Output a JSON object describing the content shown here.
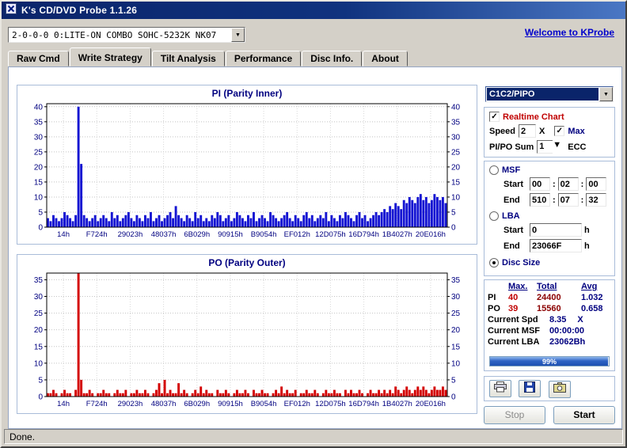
{
  "window": {
    "title": "K's CD/DVD Probe 1.1.26",
    "status": "Done."
  },
  "icons": {
    "dropdown": "▼",
    "check": "✓"
  },
  "toolbar": {
    "drive": "2-0-0-0 0:LITE-ON COMBO SOHC-5232K NK07",
    "welcome": "Welcome to KProbe"
  },
  "tabs": [
    {
      "label": "Raw Cmd"
    },
    {
      "label": "Write Strategy"
    },
    {
      "label": "Tilt Analysis"
    },
    {
      "label": "Performance"
    },
    {
      "label": "Disc Info."
    },
    {
      "label": "About"
    }
  ],
  "controls": {
    "mode": "C1C2/PIPO",
    "realtime": "Realtime Chart",
    "speed_label": "Speed",
    "speed_value": "2",
    "speed_unit": "X",
    "max_label": "Max",
    "sum_label": "PI/PO Sum",
    "sum_value": "1",
    "ecc_label": "ECC",
    "msf": {
      "label": "MSF",
      "start_label": "Start",
      "end_label": "End",
      "sep": ":",
      "start": [
        "00",
        "02",
        "00"
      ],
      "end": [
        "510",
        "07",
        "32"
      ]
    },
    "lba": {
      "label": "LBA",
      "start_label": "Start",
      "end_label": "End",
      "unit": "h",
      "start": "0",
      "end": "23066F"
    },
    "disc_size": "Disc Size",
    "stats": {
      "col_max": "Max.",
      "col_total": "Total",
      "col_avg": "Avg",
      "pi": {
        "name": "PI",
        "max": "40",
        "total": "24400",
        "avg": "1.032"
      },
      "po": {
        "name": "PO",
        "max": "39",
        "total": "15560",
        "avg": "0.658"
      },
      "current_spd_label": "Current Spd",
      "current_spd_value": "8.35",
      "current_spd_unit": "X",
      "current_msf_label": "Current MSF",
      "current_msf_value": "00:00:00",
      "current_lba_label": "Current LBA",
      "current_lba_value": "23062Bh",
      "progress_pct": 99,
      "progress_label": "99%"
    },
    "stop": "Stop",
    "start": "Start"
  },
  "chart_data": [
    {
      "type": "bar",
      "title": "PI (Parity Inner)",
      "color": "#1414d2",
      "ylim": [
        0,
        41
      ],
      "yticks": [
        0,
        5,
        10,
        15,
        20,
        25,
        30,
        35,
        40
      ],
      "x_labels": [
        "14h",
        "F724h",
        "29023h",
        "48037h",
        "6B029h",
        "90915h",
        "B9054h",
        "EF012h",
        "12D075h",
        "16D794h",
        "1B4027h",
        "20E016h"
      ],
      "values": [
        3,
        2,
        4,
        3,
        2,
        3,
        5,
        4,
        3,
        2,
        4,
        40,
        21,
        4,
        3,
        2,
        3,
        4,
        2,
        3,
        4,
        3,
        2,
        5,
        3,
        4,
        2,
        3,
        4,
        5,
        3,
        2,
        4,
        3,
        2,
        4,
        3,
        5,
        2,
        3,
        4,
        2,
        3,
        4,
        5,
        3,
        7,
        4,
        3,
        2,
        4,
        3,
        2,
        5,
        3,
        4,
        2,
        3,
        2,
        4,
        3,
        5,
        4,
        2,
        3,
        4,
        2,
        3,
        5,
        4,
        3,
        2,
        4,
        3,
        5,
        2,
        3,
        4,
        3,
        2,
        5,
        4,
        3,
        2,
        3,
        4,
        5,
        3,
        2,
        4,
        3,
        2,
        4,
        5,
        3,
        4,
        2,
        3,
        4,
        3,
        5,
        2,
        4,
        3,
        2,
        4,
        3,
        5,
        4,
        3,
        2,
        4,
        5,
        3,
        4,
        2,
        3,
        4,
        5,
        4,
        5,
        6,
        5,
        7,
        6,
        8,
        7,
        6,
        9,
        8,
        10,
        9,
        8,
        10,
        11,
        9,
        10,
        8,
        9,
        11,
        10,
        9,
        10,
        8
      ]
    },
    {
      "type": "bar",
      "title": "PO (Parity Outer)",
      "color": "#d40000",
      "ylim": [
        0,
        37
      ],
      "yticks": [
        0,
        5,
        10,
        15,
        20,
        25,
        30,
        35
      ],
      "x_labels": [
        "14h",
        "F724h",
        "29023h",
        "48037h",
        "6B029h",
        "90915h",
        "B9054h",
        "EF012h",
        "12D075h",
        "16D794h",
        "1B4027h",
        "20E016h"
      ],
      "values": [
        1,
        1,
        2,
        1,
        0,
        1,
        2,
        1,
        1,
        0,
        2,
        39,
        5,
        1,
        1,
        2,
        1,
        0,
        1,
        1,
        2,
        1,
        1,
        0,
        1,
        2,
        1,
        1,
        2,
        0,
        1,
        1,
        2,
        1,
        1,
        2,
        1,
        0,
        1,
        2,
        4,
        1,
        5,
        1,
        2,
        1,
        1,
        4,
        1,
        2,
        1,
        0,
        1,
        2,
        1,
        3,
        1,
        2,
        1,
        1,
        0,
        2,
        1,
        1,
        2,
        1,
        0,
        1,
        2,
        1,
        1,
        2,
        1,
        0,
        2,
        1,
        1,
        2,
        1,
        1,
        0,
        1,
        2,
        1,
        3,
        1,
        2,
        1,
        1,
        2,
        0,
        1,
        1,
        2,
        1,
        1,
        2,
        1,
        0,
        1,
        2,
        1,
        1,
        2,
        1,
        1,
        0,
        2,
        1,
        2,
        1,
        1,
        2,
        1,
        0,
        1,
        2,
        1,
        1,
        2,
        1,
        2,
        1,
        2,
        1,
        3,
        2,
        1,
        2,
        3,
        2,
        1,
        2,
        3,
        2,
        3,
        2,
        1,
        2,
        3,
        2,
        2,
        3,
        2
      ]
    }
  ]
}
